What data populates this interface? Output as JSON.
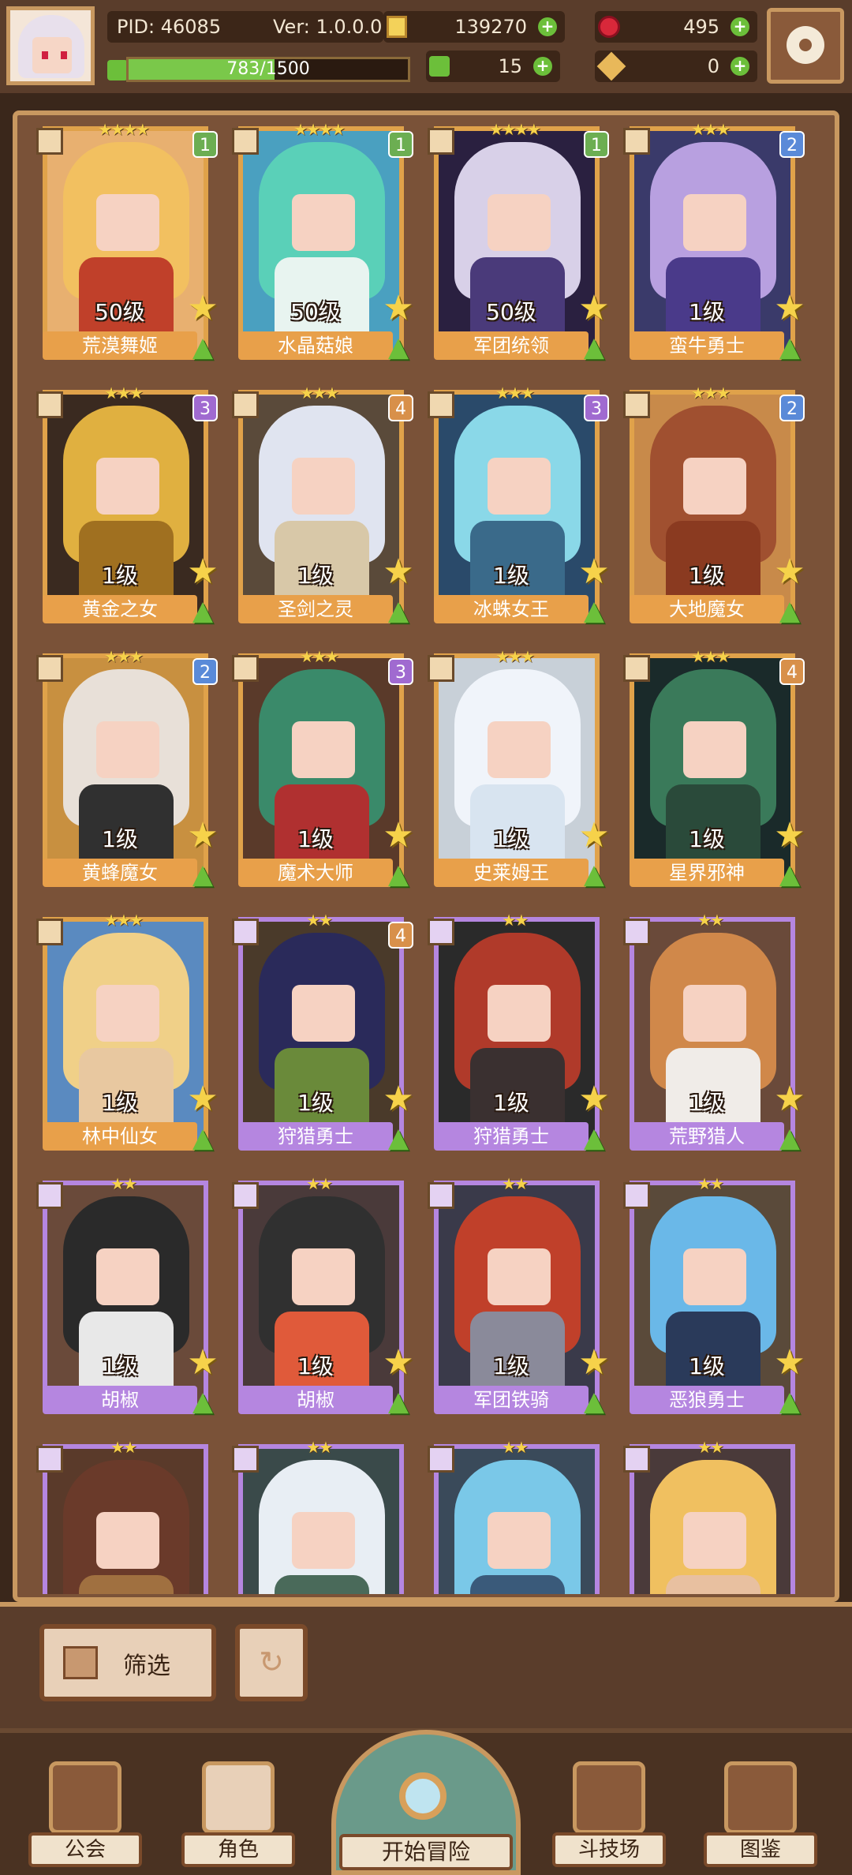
{
  "player": {
    "pid": "PID: 46085",
    "version": "Ver: 1.0.0.0",
    "exp_text": "783/1500",
    "exp_fraction": 0.522
  },
  "currencies": {
    "gold": "139270",
    "gems": "495",
    "leaves": "15",
    "keys": "0"
  },
  "characters": [
    {
      "name": "荒漠舞姬",
      "level": "50级",
      "stars": "★★★★",
      "rank": "1",
      "frame": "gold",
      "hair": "#f2c060",
      "body": "#c0402a",
      "bg": "#e8b070"
    },
    {
      "name": "水晶菇娘",
      "level": "50级",
      "stars": "★★★★",
      "rank": "1",
      "frame": "gold",
      "hair": "#5ad0b8",
      "body": "#e8f4f0",
      "bg": "#4aa0c0"
    },
    {
      "name": "军团统领",
      "level": "50级",
      "stars": "★★★★",
      "rank": "1",
      "frame": "gold",
      "hair": "#d8d0e8",
      "body": "#4a3a7a",
      "bg": "#2a2040"
    },
    {
      "name": "蛮牛勇士",
      "level": "1级",
      "stars": "★★★",
      "rank": "2",
      "frame": "gold",
      "hair": "#b8a0e0",
      "body": "#4a3a8a",
      "bg": "#3a3a6a"
    },
    {
      "name": "黄金之女",
      "level": "1级",
      "stars": "★★★",
      "rank": "3",
      "frame": "gold",
      "hair": "#e0b040",
      "body": "#a07020",
      "bg": "#3a2a20"
    },
    {
      "name": "圣剑之灵",
      "level": "1级",
      "stars": "★★★",
      "rank": "4",
      "frame": "gold",
      "hair": "#e0e4f0",
      "body": "#d8c8a8",
      "bg": "#5a4a3a"
    },
    {
      "name": "冰蛛女王",
      "level": "1级",
      "stars": "★★★",
      "rank": "3",
      "frame": "gold",
      "hair": "#8ad8e8",
      "body": "#3a6a8a",
      "bg": "#2a4a6a"
    },
    {
      "name": "大地魔女",
      "level": "1级",
      "stars": "★★★",
      "rank": "2",
      "frame": "gold",
      "hair": "#a05030",
      "body": "#8a3a20",
      "bg": "#c88a4a"
    },
    {
      "name": "黄蜂魔女",
      "level": "1级",
      "stars": "★★★",
      "rank": "2",
      "frame": "gold",
      "hair": "#e8e0d8",
      "body": "#303030",
      "bg": "#c89040"
    },
    {
      "name": "魔术大师",
      "level": "1级",
      "stars": "★★★",
      "rank": "3",
      "frame": "gold",
      "hair": "#3a8a6a",
      "body": "#b03030",
      "bg": "#5a3a2a"
    },
    {
      "name": "史莱姆王",
      "level": "1级",
      "stars": "★★★",
      "rank": "",
      "frame": "gold",
      "hair": "#f0f4fa",
      "body": "#d8e4f0",
      "bg": "#c8d0d8"
    },
    {
      "name": "星界邪神",
      "level": "1级",
      "stars": "★★★",
      "rank": "4",
      "frame": "gold",
      "hair": "#3a7a5a",
      "body": "#2a4a3a",
      "bg": "#1a2a2a"
    },
    {
      "name": "林中仙女",
      "level": "1级",
      "stars": "★★★",
      "rank": "",
      "frame": "gold",
      "hair": "#f0d088",
      "body": "#e8c8a0",
      "bg": "#5a8ac0"
    },
    {
      "name": "狩猎勇士",
      "level": "1级",
      "stars": "★★",
      "rank": "4",
      "frame": "purple",
      "hair": "#2a2a5a",
      "body": "#6a8a3a",
      "bg": "#4a3a2a"
    },
    {
      "name": "狩猎勇士",
      "level": "1级",
      "stars": "★★",
      "rank": "",
      "frame": "purple",
      "hair": "#b03a2a",
      "body": "#3a3030",
      "bg": "#2a2a2a"
    },
    {
      "name": "荒野猎人",
      "level": "1级",
      "stars": "★★",
      "rank": "",
      "frame": "purple",
      "hair": "#d0884a",
      "body": "#f0ece8",
      "bg": "#6a4a3a"
    },
    {
      "name": "胡椒",
      "level": "1级",
      "stars": "★★",
      "rank": "",
      "frame": "purple",
      "hair": "#2a2a2a",
      "body": "#e8e8e8",
      "bg": "#6a4a3a"
    },
    {
      "name": "胡椒",
      "level": "1级",
      "stars": "★★",
      "rank": "",
      "frame": "purple",
      "hair": "#303030",
      "body": "#e05a3a",
      "bg": "#4a3a3a"
    },
    {
      "name": "军团铁骑",
      "level": "1级",
      "stars": "★★",
      "rank": "",
      "frame": "purple",
      "hair": "#c0402a",
      "body": "#8a8a9a",
      "bg": "#3a3a4a"
    },
    {
      "name": "恶狼勇士",
      "level": "1级",
      "stars": "★★",
      "rank": "",
      "frame": "purple",
      "hair": "#6ab8e8",
      "body": "#2a3a5a",
      "bg": "#5a4a3a"
    },
    {
      "name": "",
      "level": "",
      "stars": "★★",
      "rank": "",
      "frame": "purple",
      "hair": "#6a3a2a",
      "body": "#a07040",
      "bg": "#5a3a2a"
    },
    {
      "name": "",
      "level": "",
      "stars": "★★",
      "rank": "",
      "frame": "purple",
      "hair": "#e8eef4",
      "body": "#4a6a5a",
      "bg": "#3a4a4a"
    },
    {
      "name": "",
      "level": "",
      "stars": "★★",
      "rank": "",
      "frame": "purple",
      "hair": "#7ac8e8",
      "body": "#3a5a7a",
      "bg": "#3a4a5a"
    },
    {
      "name": "",
      "level": "",
      "stars": "★★",
      "rank": "",
      "frame": "purple",
      "hair": "#f0c060",
      "body": "#e8c0a0",
      "bg": "#4a3a3a"
    }
  ],
  "toolbar": {
    "filter_label": "筛选"
  },
  "nav": {
    "guild": "公会",
    "character": "角色",
    "adventure": "开始冒险",
    "arena": "斗技场",
    "codex": "图鉴"
  },
  "colors": {
    "gold_frame": "#e0a24a",
    "purple_frame": "#b586e0",
    "rank_colors": {
      "1": "#6cae52",
      "2": "#5a8ad8",
      "3": "#a06ad0",
      "4": "#d8904a"
    }
  }
}
